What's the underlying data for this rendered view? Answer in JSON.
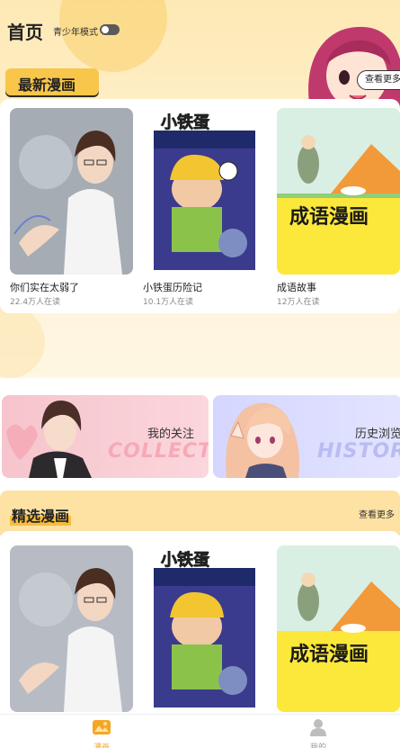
{
  "header": {
    "title": "首页",
    "teen_mode_label": "青少年模式",
    "teen_mode_on": false
  },
  "latest": {
    "title": "最新漫画",
    "see_more": "查看更多",
    "items": [
      {
        "title": "你们实在太弱了",
        "readers": "22.4万人在读"
      },
      {
        "title": "小铁蛋历险记",
        "readers": "10.1万人在读"
      },
      {
        "title": "成语故事",
        "readers": "12万人在读"
      }
    ]
  },
  "tiles": {
    "collect": {
      "label": "我的关注",
      "watermark": "COLLECT"
    },
    "history": {
      "label": "历史浏览",
      "watermark": "HISTORY"
    }
  },
  "featured": {
    "title": "精选漫画",
    "see_more": "查看更多",
    "cover_text": "成语漫画"
  },
  "covers": {
    "xiaotiedan_logo": "小铁蛋",
    "chengyu_text": "成语漫画"
  },
  "tabbar": {
    "items": [
      {
        "label": "漫画",
        "icon": "comic-icon",
        "active": true
      },
      {
        "label": "我的",
        "icon": "user-icon",
        "active": false
      }
    ]
  },
  "colors": {
    "accent": "#f8c64a",
    "tab_active": "#f5a623",
    "tab_inactive": "#bdbdbd"
  }
}
